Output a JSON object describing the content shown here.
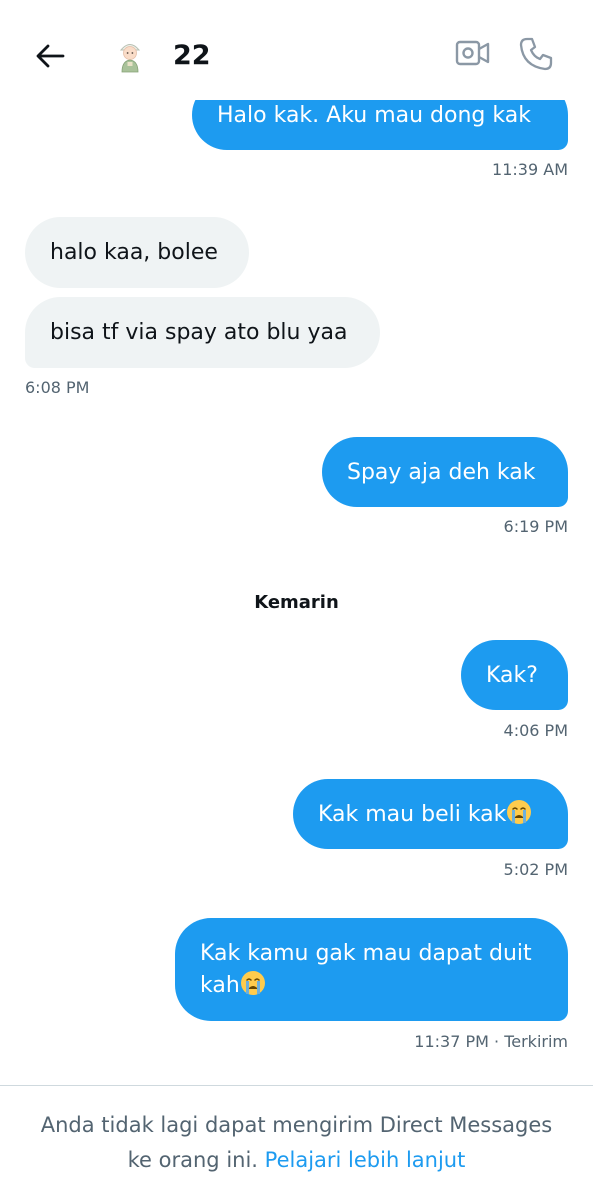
{
  "header": {
    "title": "22",
    "back_icon": "arrow-left-icon",
    "video_icon": "video-camera-icon",
    "call_icon": "phone-icon"
  },
  "messages": [
    {
      "text": "Halo kak. Aku mau dong kak",
      "time": "11:39 AM"
    },
    {
      "text": "halo kaa, bolee"
    },
    {
      "text": "bisa tf via spay ato blu yaa",
      "time": "6:08 PM"
    },
    {
      "text": "Spay aja deh kak",
      "time": "6:19 PM"
    },
    {
      "text": "Kak?",
      "time": "4:06 PM"
    },
    {
      "text": "Kak mau beli kak",
      "time": "5:02 PM"
    },
    {
      "text_line1": "Kak kamu gak mau dapat duit",
      "text_line2": "kah",
      "time": "11:37 PM · Terkirim"
    }
  ],
  "day_separator": "Kemarin",
  "footer": {
    "line1": "Anda tidak lagi dapat mengirim Direct Messages",
    "line2": "ke orang ini.",
    "link": "Pelajari lebih lanjut"
  },
  "colors": {
    "accent": "#1d9bf0",
    "received_bubble": "#eff3f4",
    "secondary_text": "#536471",
    "divider": "#cfd9de"
  }
}
